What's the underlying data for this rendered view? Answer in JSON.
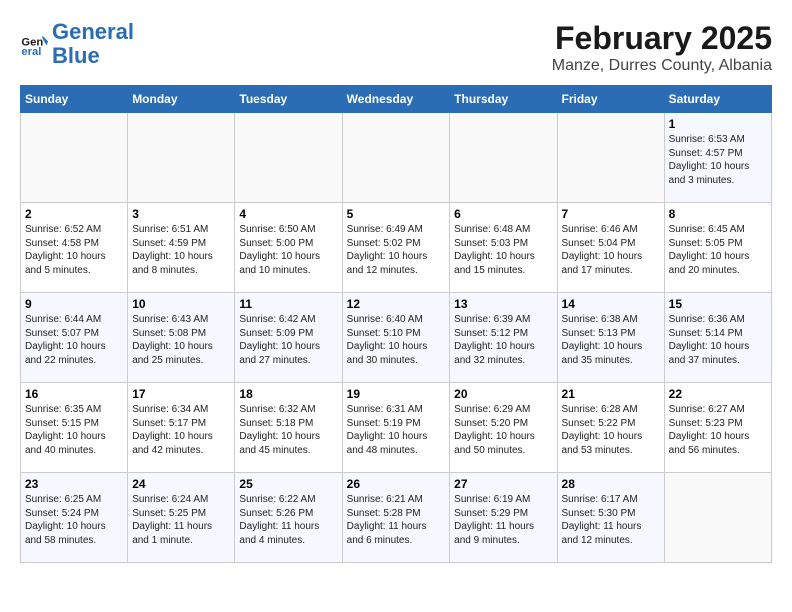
{
  "header": {
    "logo_general": "General",
    "logo_blue": "Blue",
    "title": "February 2025",
    "subtitle": "Manze, Durres County, Albania"
  },
  "weekdays": [
    "Sunday",
    "Monday",
    "Tuesday",
    "Wednesday",
    "Thursday",
    "Friday",
    "Saturday"
  ],
  "weeks": [
    [
      {
        "day": "",
        "info": ""
      },
      {
        "day": "",
        "info": ""
      },
      {
        "day": "",
        "info": ""
      },
      {
        "day": "",
        "info": ""
      },
      {
        "day": "",
        "info": ""
      },
      {
        "day": "",
        "info": ""
      },
      {
        "day": "1",
        "info": "Sunrise: 6:53 AM\nSunset: 4:57 PM\nDaylight: 10 hours and 3 minutes."
      }
    ],
    [
      {
        "day": "2",
        "info": "Sunrise: 6:52 AM\nSunset: 4:58 PM\nDaylight: 10 hours and 5 minutes."
      },
      {
        "day": "3",
        "info": "Sunrise: 6:51 AM\nSunset: 4:59 PM\nDaylight: 10 hours and 8 minutes."
      },
      {
        "day": "4",
        "info": "Sunrise: 6:50 AM\nSunset: 5:00 PM\nDaylight: 10 hours and 10 minutes."
      },
      {
        "day": "5",
        "info": "Sunrise: 6:49 AM\nSunset: 5:02 PM\nDaylight: 10 hours and 12 minutes."
      },
      {
        "day": "6",
        "info": "Sunrise: 6:48 AM\nSunset: 5:03 PM\nDaylight: 10 hours and 15 minutes."
      },
      {
        "day": "7",
        "info": "Sunrise: 6:46 AM\nSunset: 5:04 PM\nDaylight: 10 hours and 17 minutes."
      },
      {
        "day": "8",
        "info": "Sunrise: 6:45 AM\nSunset: 5:05 PM\nDaylight: 10 hours and 20 minutes."
      }
    ],
    [
      {
        "day": "9",
        "info": "Sunrise: 6:44 AM\nSunset: 5:07 PM\nDaylight: 10 hours and 22 minutes."
      },
      {
        "day": "10",
        "info": "Sunrise: 6:43 AM\nSunset: 5:08 PM\nDaylight: 10 hours and 25 minutes."
      },
      {
        "day": "11",
        "info": "Sunrise: 6:42 AM\nSunset: 5:09 PM\nDaylight: 10 hours and 27 minutes."
      },
      {
        "day": "12",
        "info": "Sunrise: 6:40 AM\nSunset: 5:10 PM\nDaylight: 10 hours and 30 minutes."
      },
      {
        "day": "13",
        "info": "Sunrise: 6:39 AM\nSunset: 5:12 PM\nDaylight: 10 hours and 32 minutes."
      },
      {
        "day": "14",
        "info": "Sunrise: 6:38 AM\nSunset: 5:13 PM\nDaylight: 10 hours and 35 minutes."
      },
      {
        "day": "15",
        "info": "Sunrise: 6:36 AM\nSunset: 5:14 PM\nDaylight: 10 hours and 37 minutes."
      }
    ],
    [
      {
        "day": "16",
        "info": "Sunrise: 6:35 AM\nSunset: 5:15 PM\nDaylight: 10 hours and 40 minutes."
      },
      {
        "day": "17",
        "info": "Sunrise: 6:34 AM\nSunset: 5:17 PM\nDaylight: 10 hours and 42 minutes."
      },
      {
        "day": "18",
        "info": "Sunrise: 6:32 AM\nSunset: 5:18 PM\nDaylight: 10 hours and 45 minutes."
      },
      {
        "day": "19",
        "info": "Sunrise: 6:31 AM\nSunset: 5:19 PM\nDaylight: 10 hours and 48 minutes."
      },
      {
        "day": "20",
        "info": "Sunrise: 6:29 AM\nSunset: 5:20 PM\nDaylight: 10 hours and 50 minutes."
      },
      {
        "day": "21",
        "info": "Sunrise: 6:28 AM\nSunset: 5:22 PM\nDaylight: 10 hours and 53 minutes."
      },
      {
        "day": "22",
        "info": "Sunrise: 6:27 AM\nSunset: 5:23 PM\nDaylight: 10 hours and 56 minutes."
      }
    ],
    [
      {
        "day": "23",
        "info": "Sunrise: 6:25 AM\nSunset: 5:24 PM\nDaylight: 10 hours and 58 minutes."
      },
      {
        "day": "24",
        "info": "Sunrise: 6:24 AM\nSunset: 5:25 PM\nDaylight: 11 hours and 1 minute."
      },
      {
        "day": "25",
        "info": "Sunrise: 6:22 AM\nSunset: 5:26 PM\nDaylight: 11 hours and 4 minutes."
      },
      {
        "day": "26",
        "info": "Sunrise: 6:21 AM\nSunset: 5:28 PM\nDaylight: 11 hours and 6 minutes."
      },
      {
        "day": "27",
        "info": "Sunrise: 6:19 AM\nSunset: 5:29 PM\nDaylight: 11 hours and 9 minutes."
      },
      {
        "day": "28",
        "info": "Sunrise: 6:17 AM\nSunset: 5:30 PM\nDaylight: 11 hours and 12 minutes."
      },
      {
        "day": "",
        "info": ""
      }
    ]
  ]
}
